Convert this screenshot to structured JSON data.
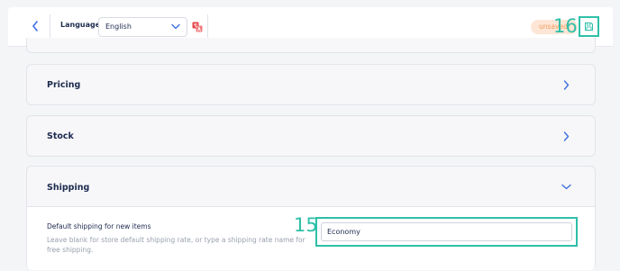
{
  "toolbar": {
    "back_icon": "chevron-left-icon",
    "language_label": "Language",
    "language_value": "English",
    "translate_icon": "translate-icon",
    "unsaved_label": "unsaved",
    "save_icon": "save-icon"
  },
  "annotations": {
    "save_marker": "16",
    "input_marker": "15"
  },
  "sections": [
    {
      "title": "Pricing",
      "state": "collapsed"
    },
    {
      "title": "Stock",
      "state": "collapsed"
    },
    {
      "title": "Shipping",
      "state": "expanded"
    }
  ],
  "shipping": {
    "field_title": "Default shipping for new items",
    "field_help": "Leave blank for store default shipping rate, or type a shipping rate name for free shipping.",
    "input_value": "Economy"
  },
  "colors": {
    "accent": "#2ebfa8",
    "primary_text": "#1c2a4f",
    "chevron": "#3d6fe0",
    "badge_bg": "#fde6d6",
    "badge_text": "#f29a5c",
    "translate_red": "#e5484d"
  }
}
